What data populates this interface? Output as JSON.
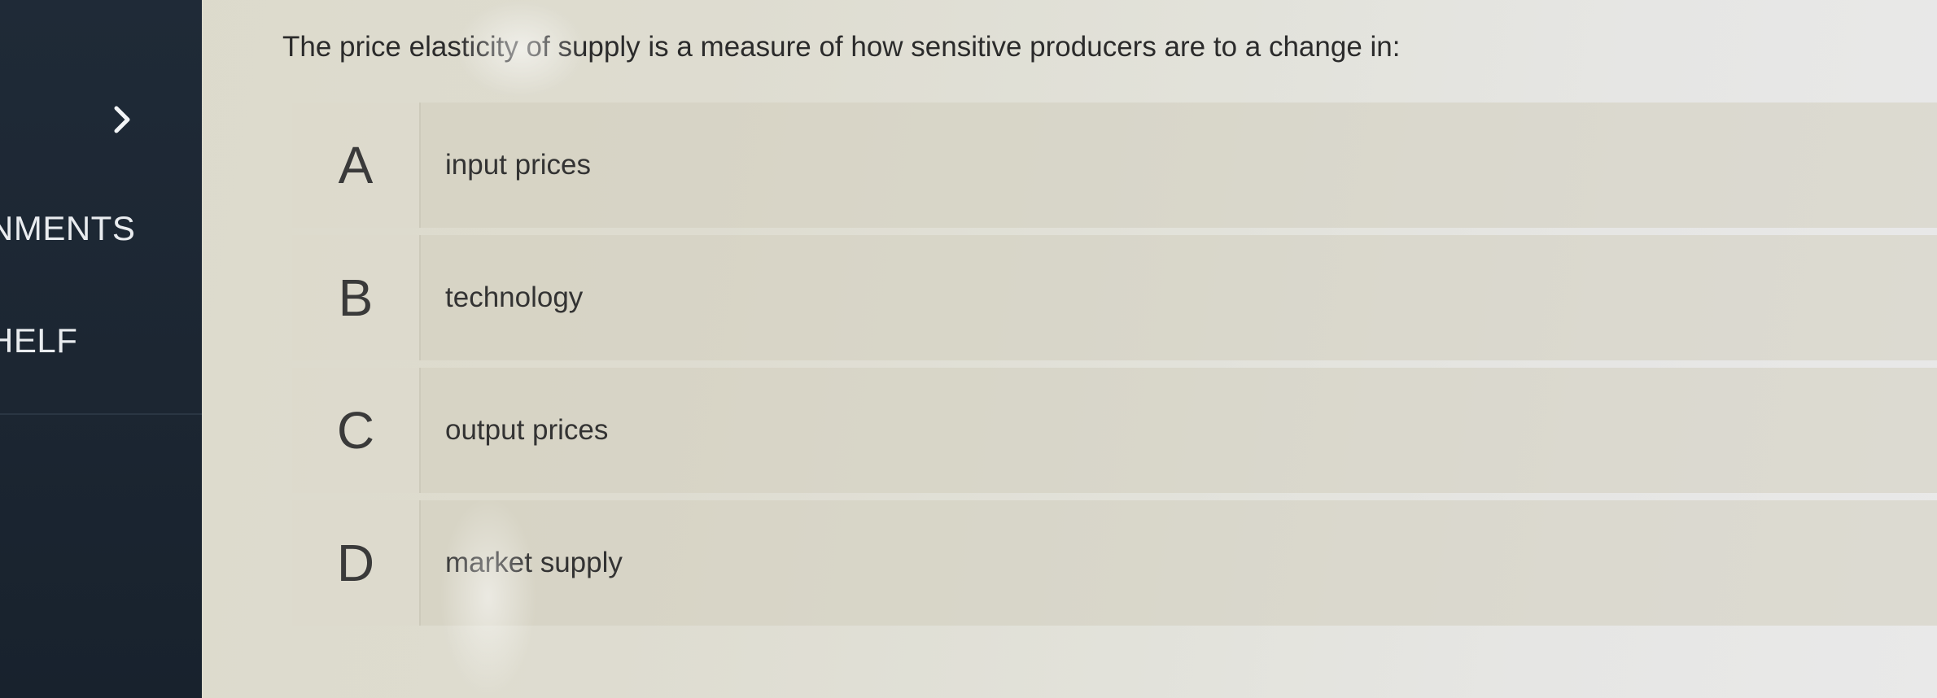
{
  "sidebar": {
    "chevron_icon": "chevron-right-icon",
    "items": [
      {
        "label": "NMENTS"
      },
      {
        "label": "HELF"
      }
    ]
  },
  "question": {
    "text": "The price elasticity of supply is a measure of how sensitive producers are to a change in:"
  },
  "options": [
    {
      "letter": "A",
      "text": "input prices"
    },
    {
      "letter": "B",
      "text": "technology"
    },
    {
      "letter": "C",
      "text": "output prices"
    },
    {
      "letter": "D",
      "text": "market supply"
    }
  ],
  "colors": {
    "sidebar_bg": "#1f2a37",
    "sidebar_text": "#e9ecef",
    "question_text": "#2b2b2b"
  }
}
